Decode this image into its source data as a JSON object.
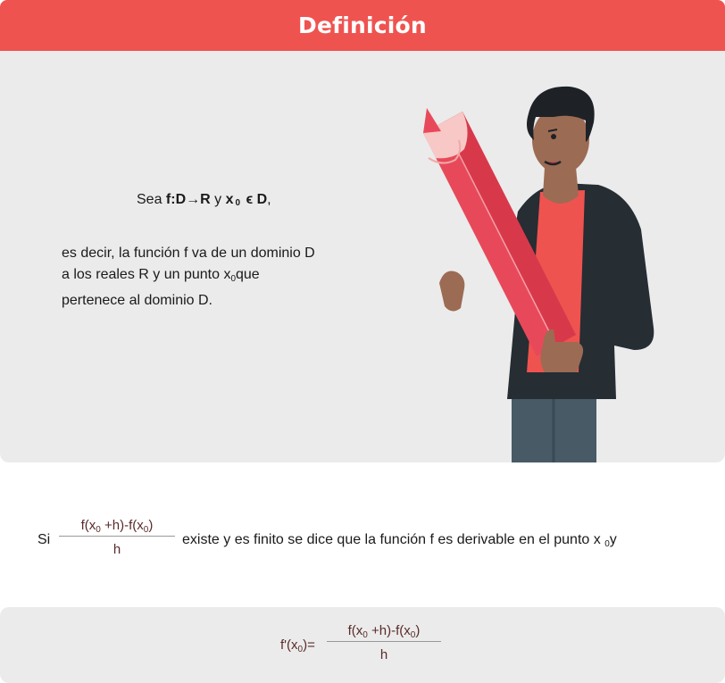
{
  "header": {
    "title": "Definición"
  },
  "definition": {
    "sea_prefix": "Sea ",
    "function_bold": "f:D→R",
    "y_word": " y ",
    "x0_bold": "x",
    "x0_sub": "0",
    "in_d_bold": " ϵ D",
    "comma": ",",
    "explanation_line1": "es decir, la función f va de un dominio D",
    "explanation_line2_a": "a los reales R y un punto x",
    "explanation_line2_sub": "0",
    "explanation_line2_b": "que",
    "explanation_line3": "pertenece al dominio D."
  },
  "derivability": {
    "si": "Si",
    "numerator_a": "f(x",
    "numerator_sub1": "0",
    "numerator_b": " +h)-f(x",
    "numerator_sub2": "0",
    "numerator_c": ")",
    "denominator": "h",
    "statement": "existe y es finito se dice que la función f es derivable en el punto x",
    "statement_sub": "0",
    "statement_end": "y"
  },
  "formula": {
    "lhs_a": "f'(x",
    "lhs_sub": "0",
    "lhs_b": ")=",
    "numerator_a": "f(x",
    "numerator_sub1": "0",
    "numerator_b": " +h)-f(x",
    "numerator_sub2": "0",
    "numerator_c": ")",
    "denominator": "h"
  },
  "colors": {
    "accent": "#ef5350",
    "panel": "#ebebeb",
    "formula_text": "#5a2a2a"
  }
}
